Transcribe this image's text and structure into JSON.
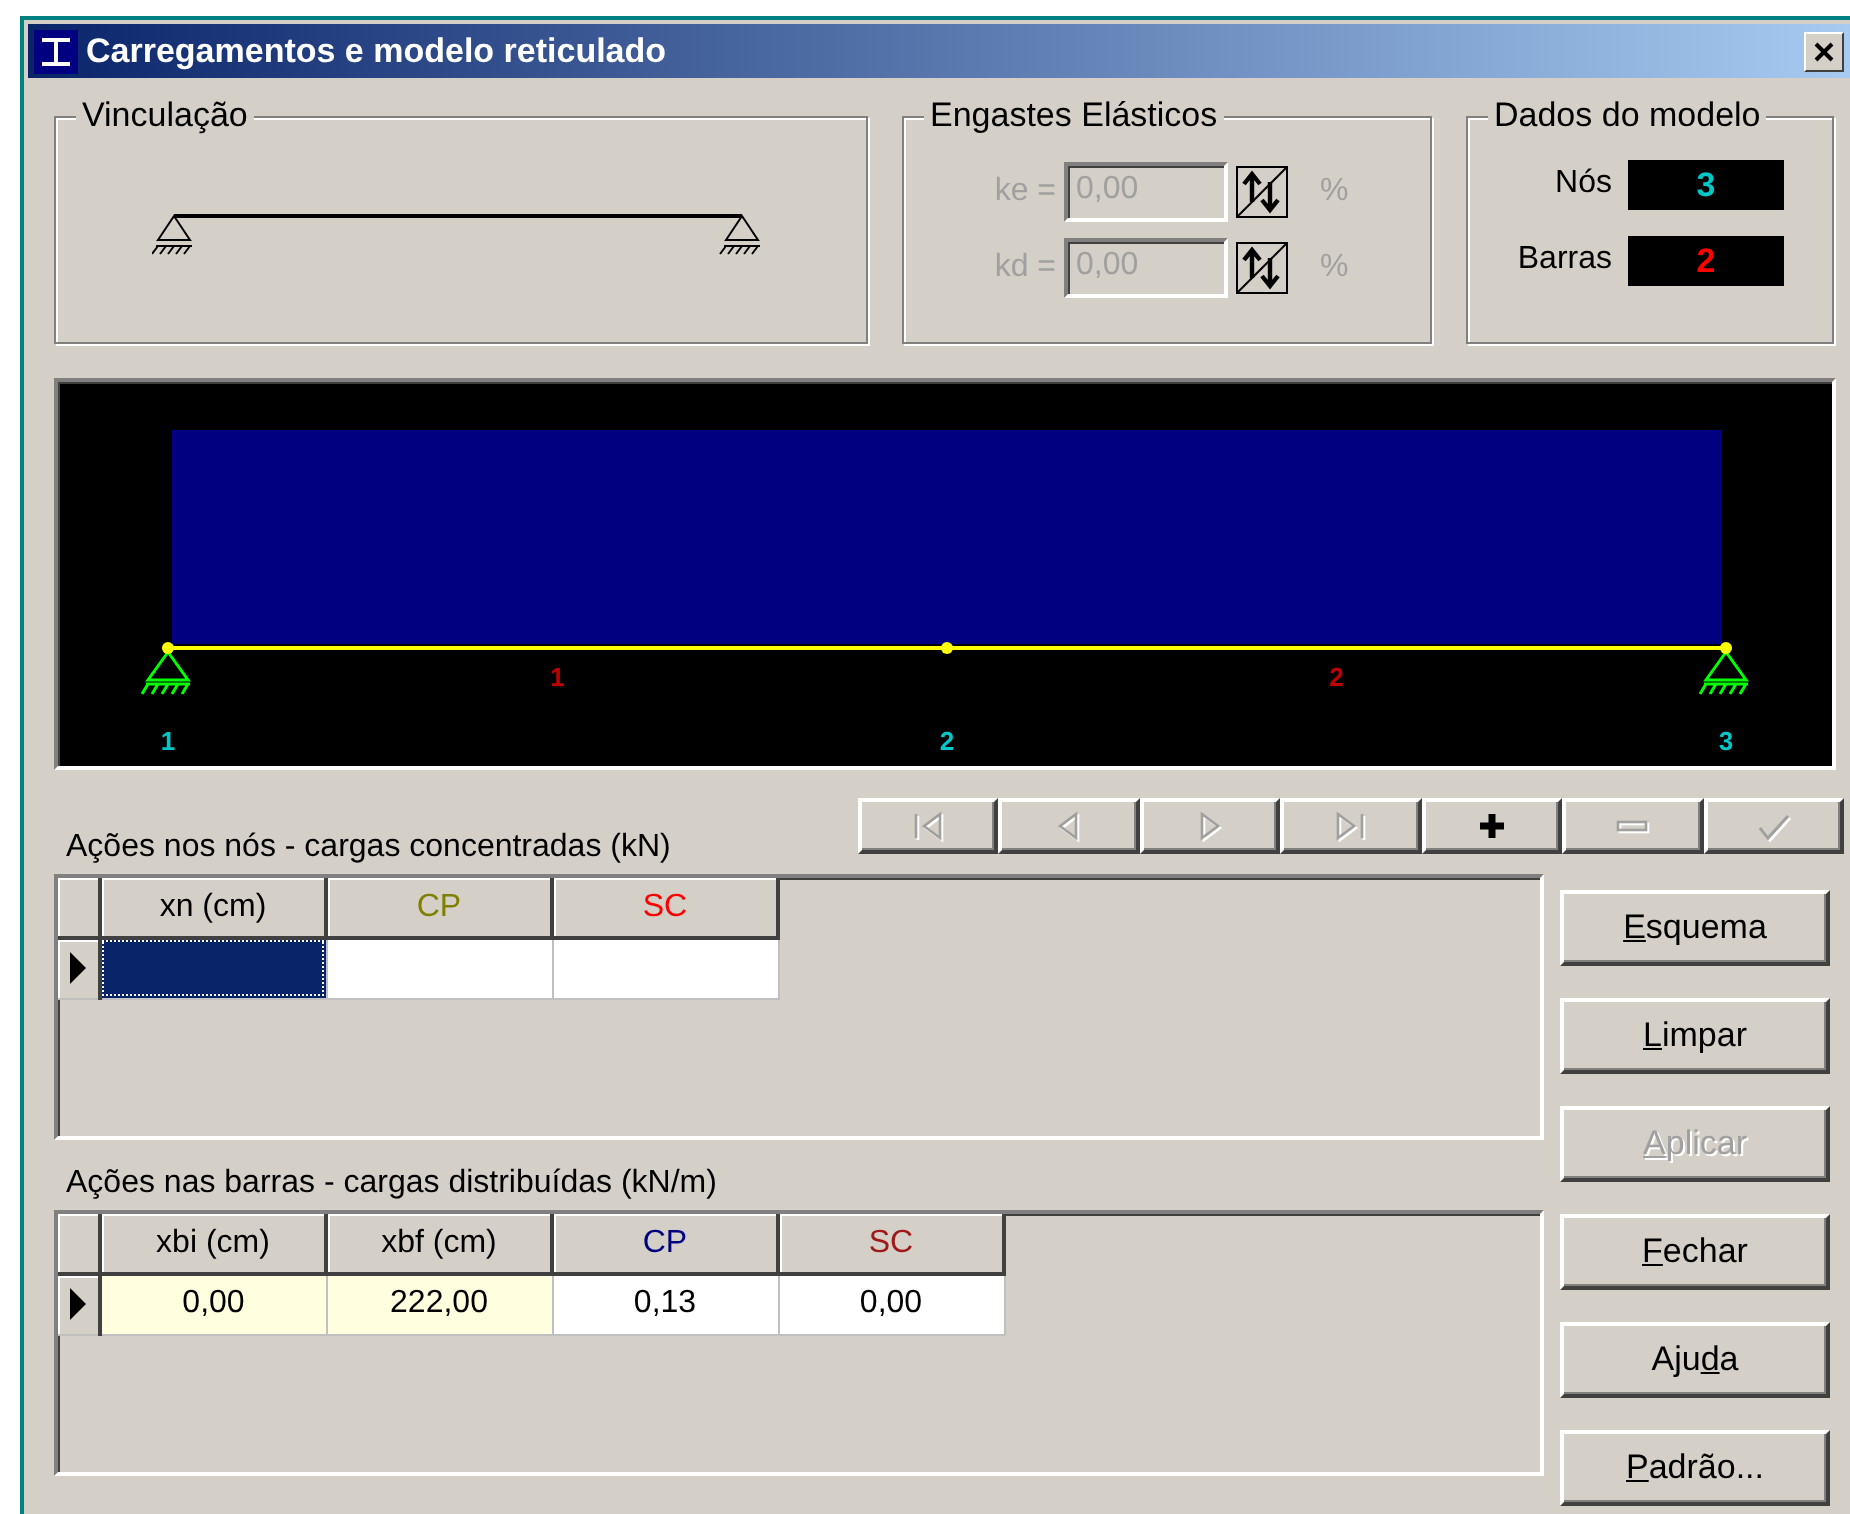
{
  "window": {
    "title": "Carregamentos e modelo reticulado"
  },
  "vinculacao": {
    "title": "Vinculação"
  },
  "engastes": {
    "title": "Engastes Elásticos",
    "fields": [
      {
        "label": "ke =",
        "value": "0,00",
        "unit": "%",
        "disabled": true
      },
      {
        "label": "kd =",
        "value": "0,00",
        "unit": "%",
        "disabled": true
      }
    ]
  },
  "dados": {
    "title": "Dados do modelo",
    "counters": [
      {
        "label": "Nós",
        "value": "3",
        "color": "#00c8c8"
      },
      {
        "label": "Barras",
        "value": "2",
        "color": "#ff0000"
      }
    ]
  },
  "diagram": {
    "distributed_load": true,
    "nodes": [
      {
        "label": "1",
        "support": true
      },
      {
        "label": "2",
        "support": false
      },
      {
        "label": "3",
        "support": true
      }
    ],
    "bars": [
      {
        "label": "1"
      },
      {
        "label": "2"
      }
    ]
  },
  "navigator": {
    "buttons": [
      {
        "kind": "first",
        "disabled": true
      },
      {
        "kind": "prior",
        "disabled": true
      },
      {
        "kind": "next",
        "disabled": true
      },
      {
        "kind": "last",
        "disabled": true
      },
      {
        "kind": "insert",
        "disabled": false
      },
      {
        "kind": "delete",
        "disabled": true
      },
      {
        "kind": "post",
        "disabled": true
      }
    ]
  },
  "nodal_loads": {
    "title": "Ações nos nós - cargas concentradas (kN)",
    "columns": [
      {
        "label": "xn (cm)",
        "color": "#000000"
      },
      {
        "label": "CP",
        "color": "#808000"
      },
      {
        "label": "SC",
        "color": "#ff0000"
      }
    ],
    "rows": [
      {
        "current": true,
        "cells": [
          {
            "selected": true
          },
          {
            "selected": false
          },
          {
            "selected": false
          }
        ]
      }
    ]
  },
  "bar_loads": {
    "title": "Ações nas barras - cargas distribuídas (kN/m)",
    "columns": [
      {
        "label": "xbi (cm)",
        "color": "#000000"
      },
      {
        "label": "xbf (cm)",
        "color": "#000000"
      },
      {
        "label": "CP",
        "color": "#000080"
      },
      {
        "label": "SC",
        "color": "#a01818"
      }
    ],
    "rows": [
      {
        "current": true,
        "cells": [
          {
            "value": "0,00",
            "readonly": true
          },
          {
            "value": "222,00",
            "readonly": true
          },
          {
            "value": "0,13",
            "readonly": false
          },
          {
            "value": "0,00",
            "readonly": false
          }
        ]
      }
    ]
  },
  "buttons": [
    {
      "accel": "E",
      "label_rest": "squema",
      "disabled": false
    },
    {
      "accel": "L",
      "label_rest": "impar",
      "disabled": false
    },
    {
      "accel": "A",
      "label_rest": "plicar",
      "disabled": true
    },
    {
      "accel": "F",
      "label_rest": "echar",
      "disabled": false
    },
    {
      "label_start": "Aju",
      "accel": "d",
      "label_rest": "a",
      "disabled": false
    },
    {
      "accel": "P",
      "label_rest": "adrão...",
      "disabled": false
    }
  ]
}
